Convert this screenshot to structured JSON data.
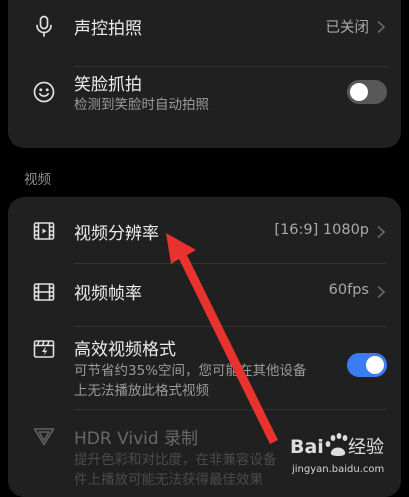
{
  "photo_settings": {
    "voice_capture": {
      "title": "声控拍照",
      "value": "已关闭",
      "icon": "microphone-icon"
    },
    "smile_capture": {
      "title": "笑脸抓拍",
      "subtitle": "检测到笑脸时自动拍照",
      "enabled": false,
      "icon": "smiley-face-icon"
    }
  },
  "video_section": {
    "label": "视频",
    "resolution": {
      "title": "视频分辨率",
      "value": "[16:9] 1080p",
      "icon": "film-play-icon"
    },
    "frame_rate": {
      "title": "视频帧率",
      "value": "60fps",
      "icon": "film-strip-icon"
    },
    "efficient_format": {
      "title": "高效视频格式",
      "subtitle_line1": "可节省约35%空间，您可能在其他设备",
      "subtitle_line2": "上无法播放此格式视频",
      "enabled": true,
      "icon": "clapperboard-icon"
    },
    "hdr_vivid": {
      "title": "HDR Vivid 录制",
      "subtitle_line1": "提升色彩和对比度，在非兼容设备",
      "subtitle_line2": "件上播放可能无法获得最佳效果",
      "icon": "hdr-triangle-icon",
      "disabled": true
    }
  },
  "colors": {
    "accent": "#3b7cf2",
    "annotation_arrow": "#e8322e"
  },
  "watermark": {
    "brand": "Baidu",
    "text": "经验",
    "url": "jingyan.baidu.com"
  }
}
